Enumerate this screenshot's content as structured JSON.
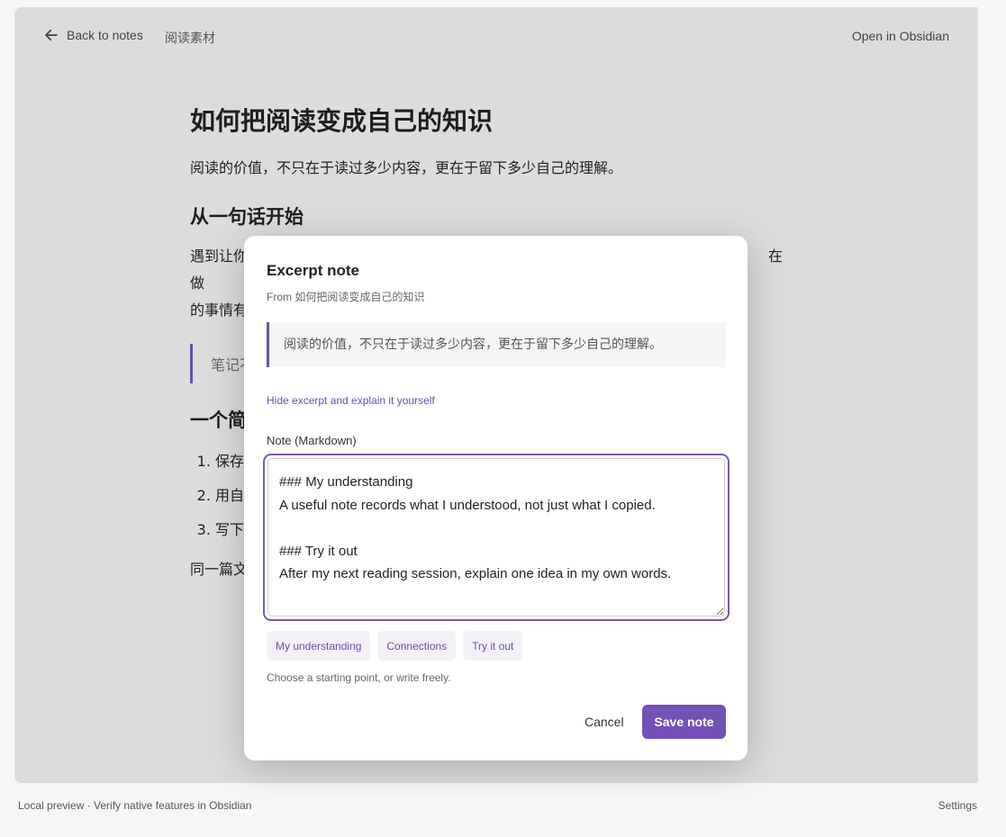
{
  "topbar": {
    "back_label": "Back to notes",
    "folder": "阅读素材",
    "open_label": "Open in Obsidian"
  },
  "article": {
    "title": "如何把阅读变成自己的知识",
    "lead": "阅读的价值，不只在于读过多少内容，更在于留下多少自己的理解。",
    "h2_first": "从一句话开始",
    "para_line1_start": "遇到让你",
    "para_line1_end": "在做",
    "para_line2_start": "的事情有",
    "quote": "笔记不",
    "h2_second": "一个简",
    "list_items": [
      "保存",
      "用自",
      "写下"
    ],
    "tail": "同一篇文"
  },
  "modal": {
    "title": "Excerpt note",
    "source_prefix": "From",
    "source_title": "如何把阅读变成自己的知识",
    "excerpt": "阅读的价值，不只在于读过多少内容，更在于留下多少自己的理解。",
    "hide_link": "Hide excerpt and explain it yourself",
    "note_label": "Note (Markdown)",
    "note_value": "### My understanding\nA useful note records what I understood, not just what I copied.\n\n### Try it out\nAfter my next reading session, explain one idea in my own words.",
    "chips": [
      "My understanding",
      "Connections",
      "Try it out"
    ],
    "hint": "Choose a starting point, or write freely.",
    "cancel_label": "Cancel",
    "save_label": "Save note"
  },
  "footer": {
    "left": "Local preview · Verify native features in Obsidian",
    "right": "Settings"
  },
  "colors": {
    "accent": "#7451b6",
    "backdrop": "#dcdcdc"
  }
}
